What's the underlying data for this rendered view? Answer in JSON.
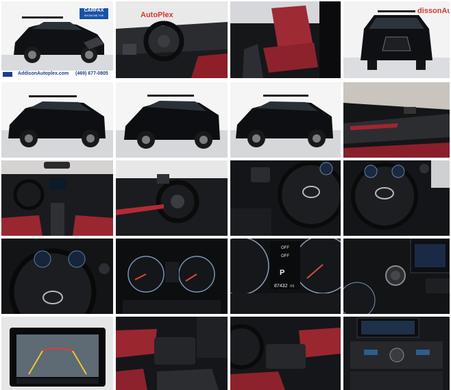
{
  "gallery": {
    "brand": {
      "badge_line1": "CARFAX",
      "badge_line2": "SHOW ME THE",
      "watermark_partial": "AutoPlex",
      "watermark_partial2": "dissonAuto",
      "footer_url": "AddisonAutoplex.com",
      "footer_phone": "(469) 677-0805"
    },
    "dash_readout": {
      "off1": "OFF",
      "off2": "OFF",
      "gear": "P",
      "odometer": "87432",
      "odometer_unit": "mi"
    }
  }
}
